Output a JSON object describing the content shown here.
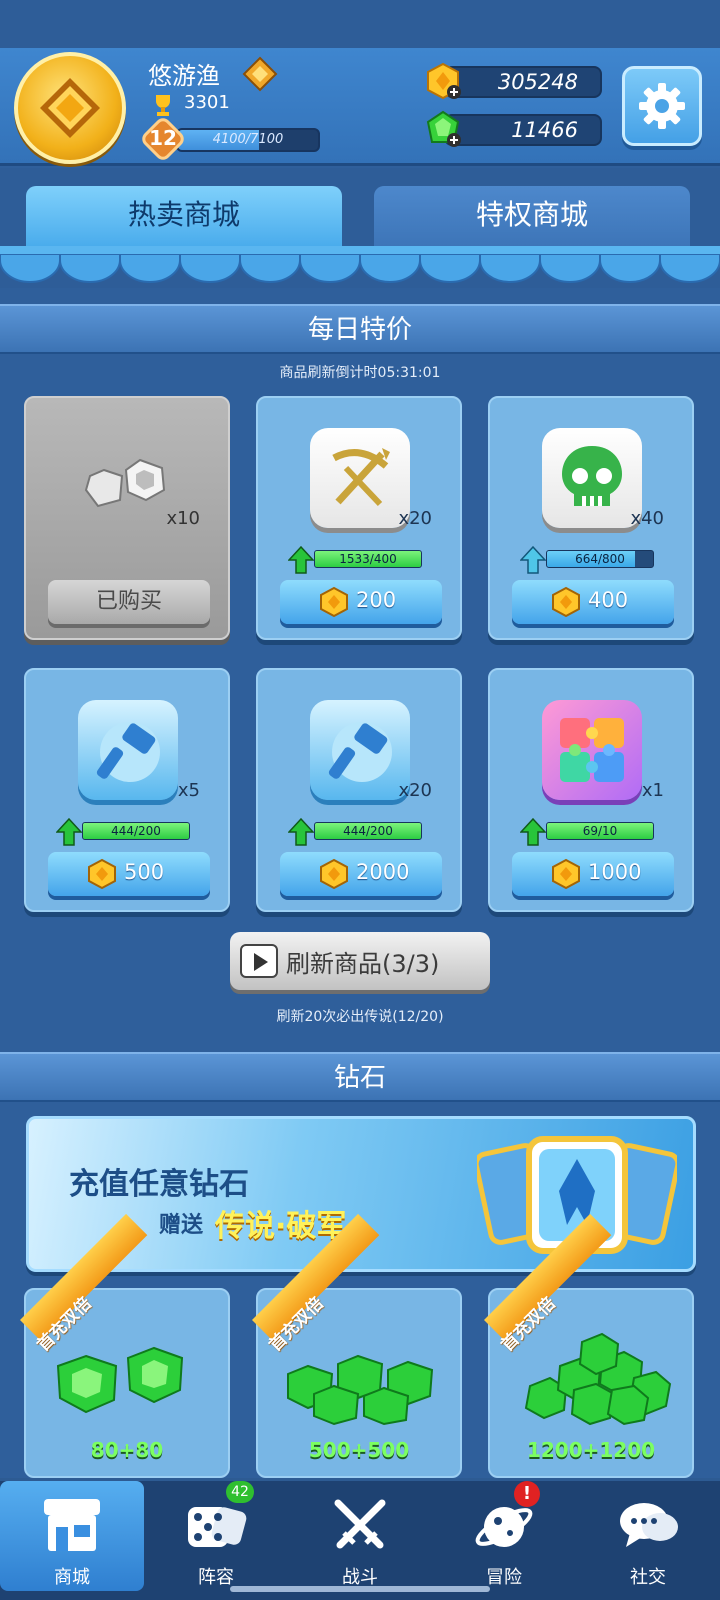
{
  "player": {
    "name": "悠游渔",
    "trophies": "3301",
    "level": "12",
    "xp_text": "4100/7100",
    "xp_fraction": 0.577
  },
  "currency": {
    "gold": "305248",
    "gems": "11466"
  },
  "tabs": [
    {
      "label": "热卖商城",
      "active": true
    },
    {
      "label": "特权商城",
      "active": false
    }
  ],
  "daily": {
    "title": "每日特价",
    "countdown": "商品刷新倒计时05:31:01",
    "items": [
      {
        "icon": "silver-gem-icon",
        "qty": "x10",
        "sold": true,
        "sold_label": "已购买"
      },
      {
        "icon": "crossbow-icon",
        "qty": "x20",
        "progress": "1533/400",
        "fraction": 1,
        "price": "200"
      },
      {
        "icon": "skull-icon",
        "qty": "x40",
        "progress": "664/800",
        "fraction": 0.83,
        "price": "400"
      },
      {
        "icon": "hammer-icon",
        "qty": "x5",
        "progress": "444/200",
        "fraction": 1,
        "price": "500"
      },
      {
        "icon": "hammer-icon",
        "qty": "x20",
        "progress": "444/200",
        "fraction": 1,
        "price": "2000"
      },
      {
        "icon": "puzzle-icon",
        "qty": "x1",
        "progress": "69/10",
        "fraction": 1,
        "price": "1000"
      }
    ],
    "refresh_label": "刷新商品(3/3)",
    "refresh_note": "刷新20次必出传说(12/20)"
  },
  "diamond": {
    "title": "钻石",
    "banner": {
      "title": "充值任意钻石",
      "gift": "赠送",
      "hero": "传说·破军"
    },
    "packs": [
      {
        "ribbon": "首充双倍",
        "amount": "80+80"
      },
      {
        "ribbon": "首充双倍",
        "amount": "500+500"
      },
      {
        "ribbon": "首充双倍",
        "amount": "1200+1200"
      }
    ]
  },
  "nav": [
    {
      "label": "商城",
      "icon": "shop-icon",
      "active": true
    },
    {
      "label": "阵容",
      "icon": "dice-icon",
      "badge": "42"
    },
    {
      "label": "战斗",
      "icon": "swords-icon"
    },
    {
      "label": "冒险",
      "icon": "planet-icon",
      "alert": "!"
    },
    {
      "label": "社交",
      "icon": "chat-icon"
    }
  ],
  "colors": {
    "background": "#2f5f9b",
    "accent_blue": "#44a4ea",
    "progress_green": "#2dcd43",
    "gold": "#f2b11a"
  }
}
